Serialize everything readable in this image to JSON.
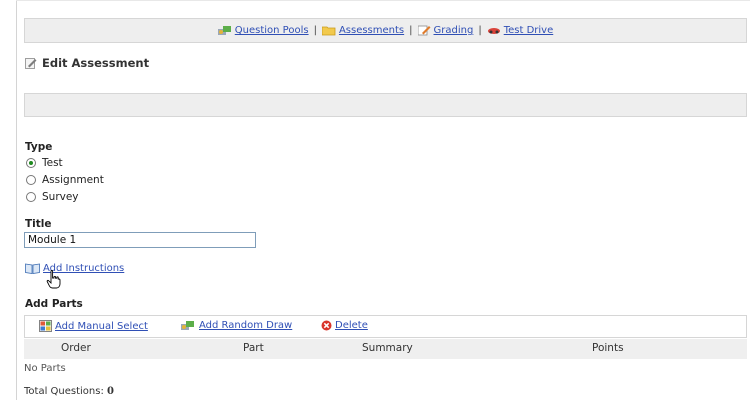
{
  "nav": {
    "question_pools": "Question Pools",
    "assessments": "Assessments",
    "grading": "Grading",
    "test_drive": "Test Drive",
    "separator": "|"
  },
  "page": {
    "title": "Edit Assessment"
  },
  "type_section": {
    "label": "Type",
    "options": [
      {
        "label": "Test",
        "selected": true
      },
      {
        "label": "Assignment",
        "selected": false
      },
      {
        "label": "Survey",
        "selected": false
      }
    ]
  },
  "title_section": {
    "label": "Title",
    "value": "Module 1"
  },
  "instructions": {
    "link": "Add Instructions"
  },
  "parts": {
    "heading": "Add Parts",
    "actions": {
      "manual": "Add Manual Select",
      "random": "Add Random Draw",
      "delete": "Delete"
    },
    "columns": [
      "Order",
      "Part",
      "Summary",
      "Points"
    ],
    "empty_text": "No Parts"
  },
  "totals": {
    "label": "Total Questions:",
    "value": "0"
  },
  "colors": {
    "link": "#2f4fb5",
    "bar_bg": "#eeeeee",
    "header_bg": "#efefef",
    "radio_fill": "#1f8a1f"
  },
  "icons": [
    "question-pools-icon",
    "folder-icon",
    "pencil-icon",
    "test-drive-icon",
    "edit-icon",
    "book-icon",
    "grid-icon",
    "random-draw-icon",
    "delete-icon",
    "hand-cursor-icon"
  ]
}
